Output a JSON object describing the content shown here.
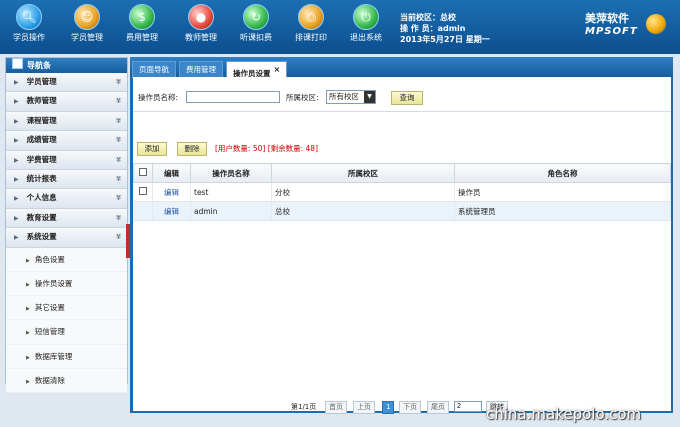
{
  "toolbar": {
    "items": [
      {
        "label": "学员操作",
        "icon": "search-icon"
      },
      {
        "label": "学员管理",
        "icon": "student-icon"
      },
      {
        "label": "费用管理",
        "icon": "money-icon"
      },
      {
        "label": "教师管理",
        "icon": "teacher-icon"
      },
      {
        "label": "听课扣费",
        "icon": "refresh-icon"
      },
      {
        "label": "排课打印",
        "icon": "print-icon"
      },
      {
        "label": "退出系统",
        "icon": "power-icon"
      }
    ]
  },
  "user_info": {
    "campus": "当前校区：总校",
    "operator": "操 作 员：admin",
    "date": "2013年5月27日 星期一"
  },
  "logo": {
    "cn": "美萍软件",
    "en": "MPSOFT"
  },
  "sidebar": {
    "title": "导航条",
    "groups": [
      {
        "label": "学员管理"
      },
      {
        "label": "教师管理"
      },
      {
        "label": "课程管理"
      },
      {
        "label": "成绩管理"
      },
      {
        "label": "学费管理"
      },
      {
        "label": "统计报表"
      },
      {
        "label": "个人信息"
      },
      {
        "label": "教育设置"
      },
      {
        "label": "系统设置"
      }
    ],
    "subitems": [
      {
        "label": "角色设置"
      },
      {
        "label": "操作员设置"
      },
      {
        "label": "其它设置"
      },
      {
        "label": "短信管理"
      },
      {
        "label": "数据库管理"
      },
      {
        "label": "数据清除"
      }
    ]
  },
  "tabs": [
    {
      "label": "页面导航"
    },
    {
      "label": "费用管理"
    },
    {
      "label": "操作员设置"
    }
  ],
  "search": {
    "name_label": "操作员名称:",
    "name_value": "",
    "campus_label": "所属校区:",
    "campus_value": "所有校区",
    "query_button": "查询"
  },
  "actions": {
    "add": "添加",
    "delete": "删除",
    "quota": "[用户数量: 50] [剩余数量: 48]"
  },
  "table": {
    "headers": [
      "编辑",
      "操作员名称",
      "所属校区",
      "角色名称"
    ],
    "rows": [
      {
        "edit": "编辑",
        "name": "test",
        "campus": "分校",
        "role": "操作员"
      },
      {
        "edit": "编辑",
        "name": "admin",
        "campus": "总校",
        "role": "系统管理员"
      }
    ]
  },
  "pager": {
    "info": "第1/1页",
    "first": "首页",
    "prev": "上页",
    "current": "1",
    "next": "下页",
    "last": "尾页",
    "goto_value": "2",
    "jump": "跳转"
  },
  "watermark": "china.makepolo.com"
}
